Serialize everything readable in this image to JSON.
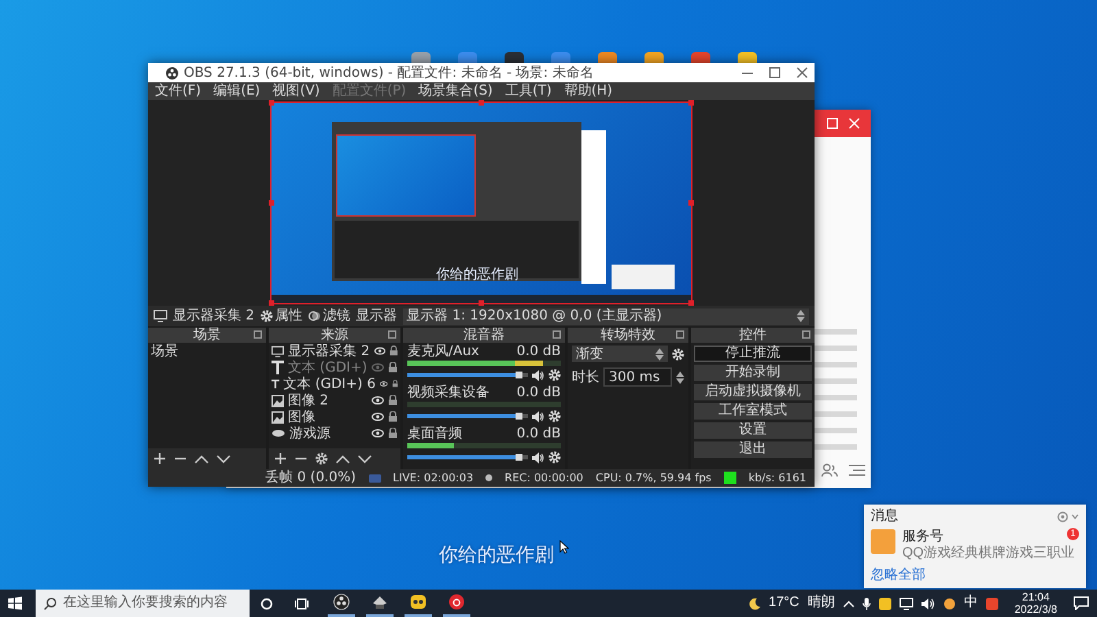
{
  "desktop": {
    "icons": [
      {
        "color": "#9aa3ad"
      },
      {
        "color": "#3d8ef0"
      },
      {
        "color": "#2b2f36"
      },
      {
        "color": "#3d8ef0"
      },
      {
        "color": "#f08a24"
      },
      {
        "color": "#f5a623"
      },
      {
        "color": "#e8452c"
      },
      {
        "color": "#f7c325"
      }
    ],
    "subtitle": "你给的恶作剧"
  },
  "obs": {
    "title": "OBS 27.1.3 (64-bit, windows) - 配置文件: 未命名 - 场景: 未命名",
    "menu": [
      {
        "label": "文件(F)",
        "disabled": false
      },
      {
        "label": "编辑(E)",
        "disabled": false
      },
      {
        "label": "视图(V)",
        "disabled": false
      },
      {
        "label": "配置文件(P)",
        "disabled": true
      },
      {
        "label": "场景集合(S)",
        "disabled": false
      },
      {
        "label": "工具(T)",
        "disabled": false
      },
      {
        "label": "帮助(H)",
        "disabled": false
      }
    ],
    "preview": {
      "caption": "你给的恶作剧"
    },
    "source_bar": {
      "source": "显示器采集 2",
      "properties": "属性",
      "filters": "滤镜",
      "display_label": "显示器",
      "display": "显示器 1: 1920x1080 @ 0,0 (主显示器)"
    },
    "scenes": {
      "title": "场景",
      "items": [
        {
          "label": "场景",
          "selected": false
        }
      ]
    },
    "sources": {
      "title": "来源",
      "items": [
        {
          "label": "显示器采集 2",
          "kind": "display",
          "visible": true,
          "selected": false
        },
        {
          "label": "文本 (GDI+)",
          "kind": "text",
          "visible": false,
          "selected": false
        },
        {
          "label": "文本 (GDI+) 6",
          "kind": "text",
          "visible": true,
          "selected": false
        },
        {
          "label": "图像 2",
          "kind": "image",
          "visible": true,
          "selected": false
        },
        {
          "label": "图像",
          "kind": "image",
          "visible": true,
          "selected": false
        },
        {
          "label": "游戏源",
          "kind": "capture",
          "visible": true,
          "selected": false
        }
      ]
    },
    "mixer": {
      "title": "混音器",
      "channels": [
        {
          "name": "麦克风/Aux",
          "reading": "0.0 dB",
          "meter": {
            "level": 0.88
          },
          "volume": {
            "level": 0.95
          }
        },
        {
          "name": "视频采集设备",
          "reading": "0.0 dB",
          "meter": {
            "level": 0.0
          },
          "volume": {
            "level": 0.95
          }
        },
        {
          "name": "桌面音频",
          "reading": "0.0 dB",
          "meter": {
            "level": 0.3
          },
          "volume": {
            "level": 0.95
          }
        }
      ]
    },
    "transitions": {
      "title": "转场特效",
      "type": "渐变",
      "duration_label": "时长",
      "duration": "300 ms"
    },
    "controls": {
      "title": "控件",
      "buttons": [
        {
          "label": "停止推流",
          "active": true
        },
        {
          "label": "开始录制",
          "active": false
        },
        {
          "label": "启动虚拟摄像机",
          "active": false
        },
        {
          "label": "工作室模式",
          "active": false
        },
        {
          "label": "设置",
          "active": false
        },
        {
          "label": "退出",
          "active": false
        }
      ]
    },
    "status": {
      "dropped": "丢帧 0 (0.0%)",
      "live": "LIVE: 02:00:03",
      "rec": "REC: 00:00:00",
      "cpu": "CPU: 0.7%, 59.94 fps",
      "bitrate": "kb/s: 6161"
    }
  },
  "notification": {
    "title": "消息",
    "items": [
      {
        "title": "服务号",
        "body": "QQ游戏经典棋牌游戏三职业",
        "badge": "1"
      }
    ],
    "dismiss": "忽略全部"
  },
  "taskbar": {
    "search_placeholder": "在这里输入你要搜索的内容",
    "temperature": "17°C",
    "weather": "晴朗",
    "ime": "中",
    "time": "21:04",
    "date": "2022/3/8"
  }
}
